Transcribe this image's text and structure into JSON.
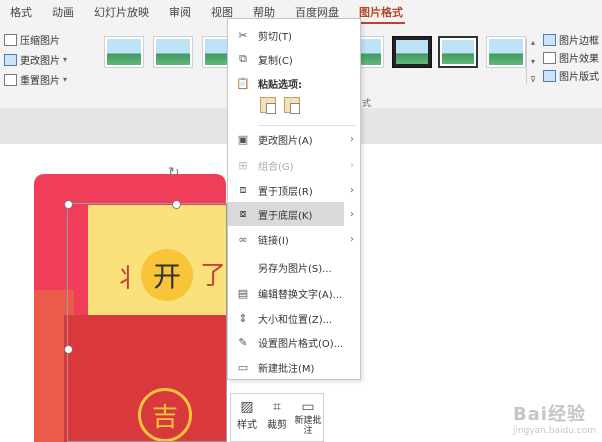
{
  "tabs": [
    {
      "label": "格式",
      "active": false
    },
    {
      "label": "动画",
      "active": false
    },
    {
      "label": "幻灯片放映",
      "active": false
    },
    {
      "label": "审阅",
      "active": false
    },
    {
      "label": "视图",
      "active": false
    },
    {
      "label": "帮助",
      "active": false
    },
    {
      "label": "百度网盘",
      "active": false
    },
    {
      "label": "图片格式",
      "active": true
    }
  ],
  "ribbon": {
    "compress": "压缩图片",
    "change_picture": "更改图片",
    "reset_picture": "重置图片",
    "picture_border": "图片边框",
    "picture_effects": "图片效果",
    "picture_layout": "图片版式",
    "group_label": "式"
  },
  "context_menu": {
    "items": [
      {
        "label": "剪切(T)",
        "icon": "scissors-icon",
        "disabled": false,
        "submenu": false
      },
      {
        "label": "复制(C)",
        "icon": "copy-icon",
        "disabled": false,
        "submenu": false
      },
      {
        "label": "粘贴选项:",
        "icon": "paste-icon",
        "disabled": false,
        "submenu": false,
        "bold": true
      },
      {
        "label": "更改图片(A)",
        "icon": "change-picture-icon",
        "disabled": false,
        "submenu": true
      },
      {
        "label": "组合(G)",
        "icon": "group-icon",
        "disabled": true,
        "submenu": true
      },
      {
        "label": "置于顶层(R)",
        "icon": "bring-to-front-icon",
        "disabled": false,
        "submenu": true
      },
      {
        "label": "置于底层(K)",
        "icon": "send-to-back-icon",
        "disabled": false,
        "submenu": true,
        "hover": true
      },
      {
        "label": "链接(I)",
        "icon": "link-icon",
        "disabled": false,
        "submenu": true
      },
      {
        "label": "另存为图片(S)...",
        "icon": "",
        "disabled": false,
        "submenu": false
      },
      {
        "label": "编辑替换文字(A)...",
        "icon": "alt-text-icon",
        "disabled": false,
        "submenu": false
      },
      {
        "label": "大小和位置(Z)...",
        "icon": "size-position-icon",
        "disabled": false,
        "submenu": false
      },
      {
        "label": "设置图片格式(O)...",
        "icon": "format-picture-icon",
        "disabled": false,
        "submenu": false
      },
      {
        "label": "新建批注(M)",
        "icon": "new-comment-icon",
        "disabled": false,
        "submenu": false
      }
    ]
  },
  "mini_toolbar": {
    "style": "样式",
    "crop": "裁剪",
    "new_comment": "新建批注"
  },
  "slide": {
    "coin_char": "开",
    "coin2_char": "吉",
    "deco_left": "丬",
    "deco_right": "了"
  },
  "watermark": {
    "brand": "Bai经验",
    "sub": "jingyan.baidu.com"
  }
}
